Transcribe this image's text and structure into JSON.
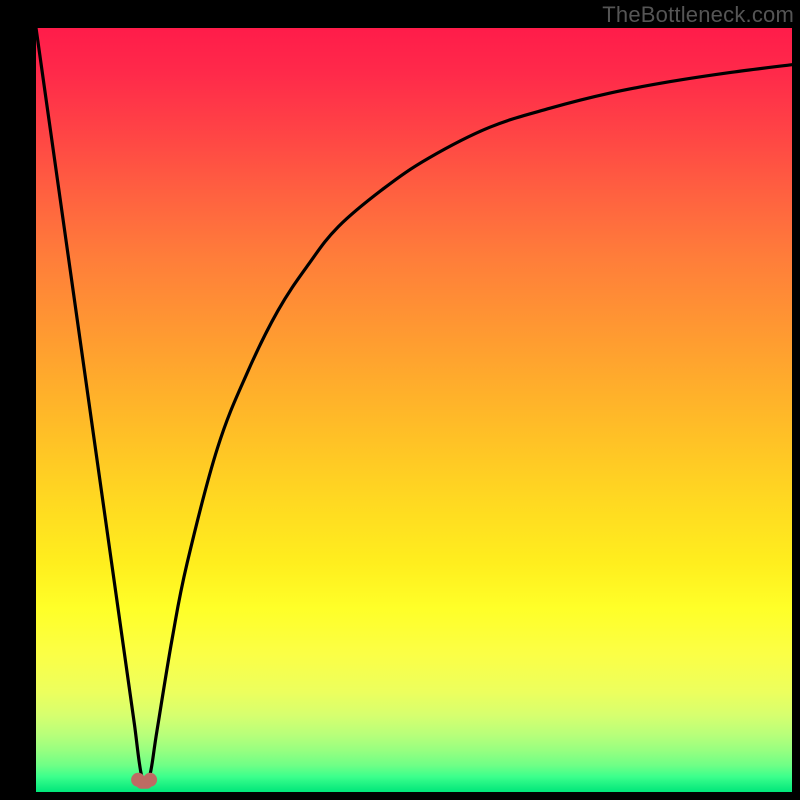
{
  "watermark": "TheBottleneck.com",
  "colors": {
    "frame": "#000000",
    "curve_stroke": "#000000",
    "marker_fill": "#bd6b63",
    "watermark_text": "#555555"
  },
  "chart_data": {
    "type": "line",
    "title": "",
    "xlabel": "",
    "ylabel": "",
    "xlim": [
      0,
      100
    ],
    "ylim": [
      0,
      100
    ],
    "grid": false,
    "legend": false,
    "series": [
      {
        "name": "bottleneck-curve",
        "x": [
          0,
          2,
          4,
          6,
          8,
          10,
          12,
          13,
          14,
          15,
          16,
          18,
          20,
          24,
          28,
          32,
          36,
          40,
          46,
          52,
          60,
          68,
          76,
          84,
          92,
          100
        ],
        "values": [
          100,
          86,
          72,
          58,
          44,
          30,
          16,
          9,
          2,
          2,
          8,
          20,
          30,
          45,
          55,
          63,
          69,
          74,
          79,
          83,
          87,
          89.5,
          91.5,
          93,
          94.2,
          95.2
        ]
      }
    ],
    "marker": {
      "x": 14.3,
      "y": 1.2
    },
    "background_gradient": {
      "top": "#ff1c4a",
      "mid": "#ffee1e",
      "bottom": "#00e67a"
    }
  }
}
